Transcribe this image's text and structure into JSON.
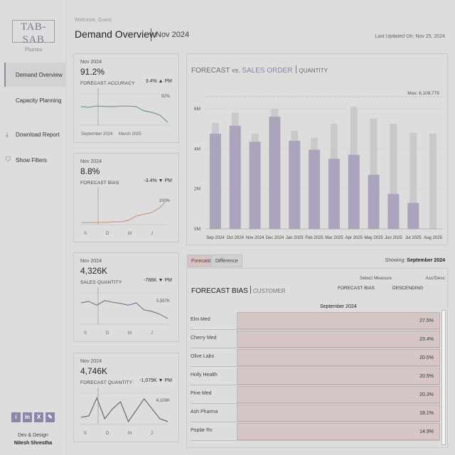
{
  "logo": {
    "line1": "TAB-SAB",
    "line2": "Pharma"
  },
  "nav": [
    {
      "label": "Demand Overview",
      "active": true
    },
    {
      "label": "Capacity Planning",
      "active": false
    }
  ],
  "actions": [
    {
      "label": "Download Report",
      "icon": "download-icon"
    },
    {
      "label": "Show Filters",
      "icon": "filter-icon"
    }
  ],
  "social": [
    "i",
    "in",
    "X",
    "✎"
  ],
  "credit": {
    "line1": "Dev & Design",
    "line2": "Nitesh Shrestha"
  },
  "header": {
    "welcome": "Welcome, Guest",
    "title": "Demand Overview",
    "subtitle": "Nov 2024",
    "updated": "Last Updated On: Nov 25, 2024"
  },
  "kpis": [
    {
      "period": "Nov 2024",
      "value": "91.2%",
      "label": "FORECAST ACCURACY",
      "change": "3.4% ▲ PM",
      "max": "92%",
      "xlabels": [
        "September 2024",
        "March 2025"
      ],
      "trend": [
        0.6,
        0.58,
        0.62,
        0.61,
        0.6,
        0.62,
        0.62,
        0.6,
        0.45,
        0.4,
        0.3,
        0.05
      ]
    },
    {
      "period": "Nov 2024",
      "value": "8.8%",
      "label": "FORECAST BIAS",
      "change": "-3.4% ▼ PM",
      "max": "100%",
      "xlabels": [
        "S",
        "D",
        "M",
        "J"
      ],
      "trend": [
        0.02,
        0.02,
        0.03,
        0.03,
        0.05,
        0.05,
        0.1,
        0.25,
        0.32,
        0.38,
        0.55,
        0.85
      ]
    },
    {
      "period": "Nov 2024",
      "value": "4,326K",
      "label": "SALES QUANTITY",
      "change": "-788K ▼ PM",
      "max": "5,557K",
      "xlabels": [
        "S",
        "D",
        "M",
        "J"
      ],
      "trend": [
        0.7,
        0.75,
        0.62,
        0.78,
        0.72,
        0.68,
        0.62,
        0.7,
        0.45,
        0.4,
        0.3,
        0.15
      ]
    },
    {
      "period": "Nov 2024",
      "value": "4,746K",
      "label": "FORECAST QUANTITY",
      "change": "-1,079K ▼ PM",
      "max": "6,109K",
      "xlabels": [
        "S",
        "D",
        "M",
        "J"
      ],
      "trend": [
        0.2,
        0.25,
        0.88,
        0.15,
        0.5,
        0.75,
        0.05,
        0.45,
        0.85,
        0.5,
        0.15,
        0.05
      ]
    }
  ],
  "forecast_chart": {
    "title_a": "FORECAST",
    "title_vs": "vs.",
    "title_b": "SALES ORDER",
    "title_unit": "QUANTITY",
    "max_label": "Max: 6,108,779"
  },
  "tabs": [
    "Forecast",
    "Difference"
  ],
  "showing": {
    "label": "Showing:",
    "value": "September 2024"
  },
  "bias": {
    "title": "FORECAST BIAS",
    "subtitle": "CUSTOMER",
    "select_label": "Select Measure",
    "select_value": "FORECAST BIAS",
    "sort_label": "Asc/Desc",
    "sort_value": "DESCENDING",
    "column": "September 2024",
    "rows": [
      {
        "name": "Elm Med",
        "value": "27.5%"
      },
      {
        "name": "Cherry Med",
        "value": "23.4%"
      },
      {
        "name": "Olive Labs",
        "value": "20.5%"
      },
      {
        "name": "Holly Health",
        "value": "20.5%"
      },
      {
        "name": "Pine Med",
        "value": "20.3%"
      },
      {
        "name": "Ash Pharma",
        "value": "18.1%"
      },
      {
        "name": "Poplar Rx",
        "value": "14.9%"
      }
    ]
  },
  "chart_data": {
    "type": "bar",
    "categories": [
      "Sep 2024",
      "Oct 2024",
      "Nov 2024",
      "Dec 2024",
      "Jan 2025",
      "Feb 2025",
      "Mar 2025",
      "Apr 2025",
      "May 2025",
      "Jun 2025",
      "Jul 2025",
      "Aug 2025"
    ],
    "series": [
      {
        "name": "Forecast",
        "values": [
          5.3,
          5.8,
          4.75,
          6.0,
          4.9,
          4.55,
          5.25,
          6.1,
          5.5,
          5.25,
          4.8,
          4.75
        ]
      },
      {
        "name": "Sales Order",
        "values": [
          4.75,
          5.15,
          4.35,
          5.6,
          4.4,
          3.95,
          3.5,
          3.7,
          2.7,
          1.75,
          1.3,
          0
        ]
      }
    ],
    "yticks": [
      "0M",
      "2M",
      "4M",
      "6M"
    ],
    "ylim": [
      0,
      6.6
    ],
    "colors": {
      "forecast": "#c9c9cc",
      "sales": "#aca4bc"
    }
  }
}
